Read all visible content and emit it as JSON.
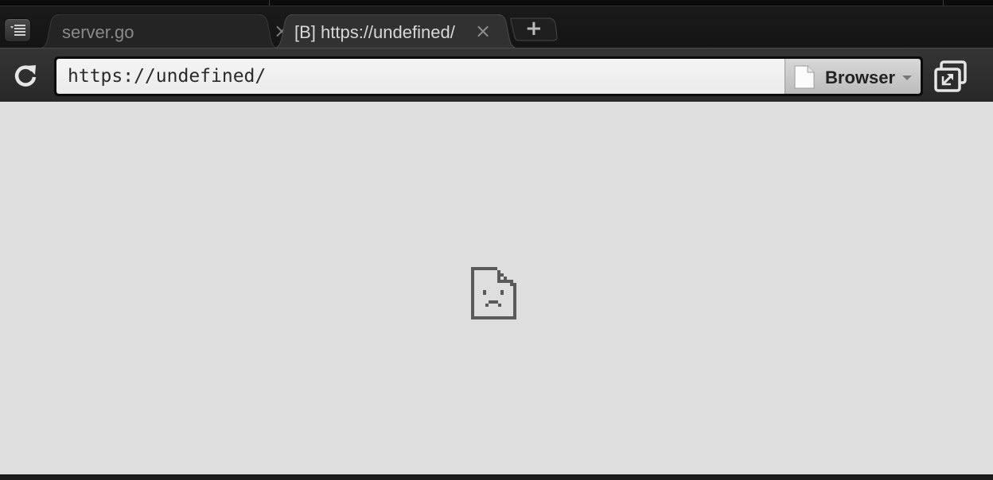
{
  "tabs": [
    {
      "title": "server.go",
      "active": false,
      "close_glyph": "×"
    },
    {
      "title": "[B] https://undefined/",
      "active": true,
      "close_glyph": "×"
    }
  ],
  "new_tab": {
    "glyph": "+"
  },
  "toolbar": {
    "reload_icon": "reload-icon",
    "menu_icon": "menu-list-icon",
    "window_icon": "window-popout-icon"
  },
  "address_bar": {
    "value": "https://undefined/",
    "mode_icon": "page-icon",
    "mode_selected": "Browser"
  },
  "content": {
    "state": "page-error",
    "icon": "sad-page-icon"
  },
  "colors": {
    "chrome_dark": "#1b1b1b",
    "toolbar": "#2f2f2f",
    "active_tab": "#303030",
    "inactive_tab": "#232323",
    "content_bg": "#dedede",
    "error_icon": "#5a5a5a"
  }
}
